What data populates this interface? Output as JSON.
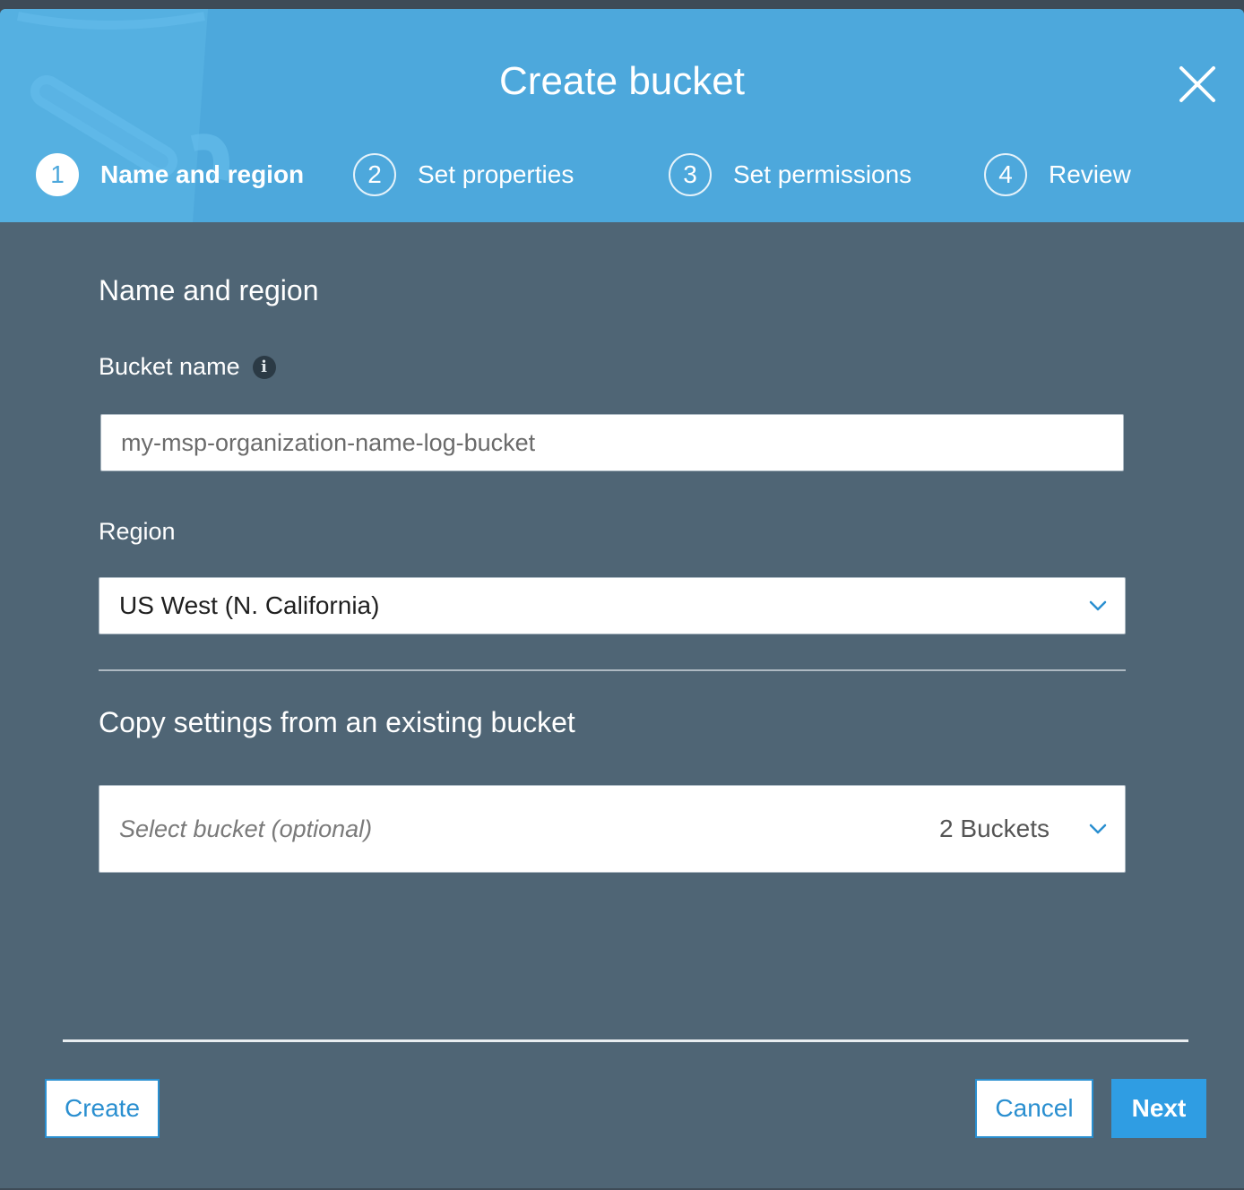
{
  "dialog": {
    "title": "Create bucket"
  },
  "steps": [
    {
      "number": "1",
      "label": "Name and region",
      "active": true
    },
    {
      "number": "2",
      "label": "Set properties",
      "active": false
    },
    {
      "number": "3",
      "label": "Set permissions",
      "active": false
    },
    {
      "number": "4",
      "label": "Review",
      "active": false
    }
  ],
  "form": {
    "section_title": "Name and region",
    "bucket_name_label": "Bucket name",
    "bucket_name_value": "",
    "bucket_name_placeholder": "my-msp-organization-name-log-bucket",
    "region_label": "Region",
    "region_value": "US West (N. California)",
    "copy_title": "Copy settings from an existing bucket",
    "copy_placeholder": "Select bucket (optional)",
    "copy_count": "2 Buckets"
  },
  "footer": {
    "create_label": "Create",
    "cancel_label": "Cancel",
    "next_label": "Next"
  },
  "colors": {
    "header": "#4da8dc",
    "body": "#4f6575",
    "accent": "#2f9de3"
  }
}
